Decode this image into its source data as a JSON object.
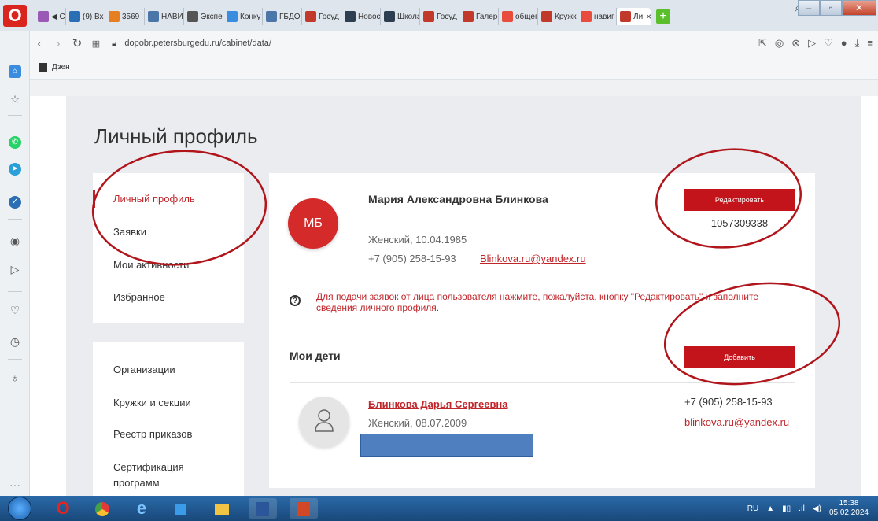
{
  "browser": {
    "logo": "O",
    "tabs": [
      {
        "label": "◀ Сл",
        "color": "#9b59b6"
      },
      {
        "label": "(9) Вх",
        "color": "#2a6fb5"
      },
      {
        "label": "3569",
        "color": "#e67e22"
      },
      {
        "label": "НАВИ",
        "color": "#4a76a8"
      },
      {
        "label": "Экспе",
        "color": "#555555"
      },
      {
        "label": "Конку",
        "color": "#3a8dde"
      },
      {
        "label": "ГБДО",
        "color": "#4a76a8"
      },
      {
        "label": "Госуд",
        "color": "#c0392b"
      },
      {
        "label": "Новос",
        "color": "#2c3e50"
      },
      {
        "label": "Школа",
        "color": "#2c3e50"
      },
      {
        "label": "Госуд",
        "color": "#c0392b"
      },
      {
        "label": "Галере",
        "color": "#c0392b"
      },
      {
        "label": "общег",
        "color": "#e74c3c"
      },
      {
        "label": "Кружк",
        "color": "#c0392b"
      },
      {
        "label": "навиг",
        "color": "#e74c3c"
      },
      {
        "label": "Ли",
        "color": "#c0392b",
        "active": true
      }
    ],
    "new_tab": "+",
    "url": "dopobr.petersburgedu.ru/cabinet/data/",
    "bookmark": "Дзен",
    "window_controls": [
      "–",
      "▫",
      "✕"
    ]
  },
  "page": {
    "title": "Личный профиль",
    "menu_primary": [
      "Личный профиль",
      "Заявки",
      "Мои активности",
      "Избранное"
    ],
    "menu_secondary": [
      "Организации",
      "Кружки и секции",
      "Реестр приказов",
      "Сертификация программ"
    ],
    "profile": {
      "initials": "МБ",
      "name": "Мария Александровна Блинкова",
      "gender_dob": "Женский, 10.04.1985",
      "phone": "+7 (905) 258-15-93",
      "email": "Blinkova.ru@yandex.ru",
      "edit_button": "Редактировать",
      "id": "1057309338"
    },
    "notice": "Для подачи заявок от лица пользователя нажмите, пожалуйста, кнопку \"Редактировать\" и заполните сведения личного профиля.",
    "help_glyph": "?",
    "children_title": "Мои дети",
    "add_button": "Добавить",
    "child": {
      "name": "Блинкова Дарья Сергеевна",
      "gender_dob": "Женский, 08.07.2009",
      "phone": "+7 (905) 258-15-93",
      "email": "blinkova.ru@yandex.ru"
    }
  },
  "taskbar": {
    "lang": "RU",
    "time": "15:38",
    "date": "05.02.2024"
  },
  "colors": {
    "accent_red": "#c3141c",
    "link_red": "#c0252a",
    "annotation_red": "#b0151b"
  }
}
